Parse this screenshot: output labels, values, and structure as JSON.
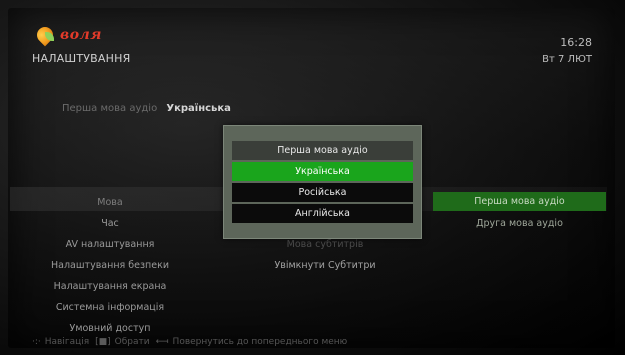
{
  "header": {
    "logo_text": "воля",
    "title": "НАЛАШТУВАННЯ",
    "time": "16:28",
    "date": "Вт 7 ЛЮТ"
  },
  "audio_setting": {
    "label": "Перша мова аудіо",
    "value": "Українська"
  },
  "menu": {
    "items": [
      {
        "label": "Мова"
      },
      {
        "label": "Час"
      },
      {
        "label": "AV налаштування"
      },
      {
        "label": "Налаштування безпеки"
      },
      {
        "label": "Налаштування екрана"
      },
      {
        "label": "Системна інформація"
      },
      {
        "label": "Умовний доступ"
      }
    ]
  },
  "submenu": {
    "items": [
      {
        "label": "Мова субтитрів"
      },
      {
        "label": "Увімкнути Субтитри"
      }
    ]
  },
  "right_list": {
    "items": [
      {
        "label": "Перша мова аудіо"
      },
      {
        "label": "Друга мова аудіо"
      }
    ]
  },
  "dialog": {
    "title": "Перша мова аудіо",
    "options": [
      {
        "label": "Українська",
        "selected": true
      },
      {
        "label": "Російська",
        "selected": false
      },
      {
        "label": "Англійська",
        "selected": false
      }
    ]
  },
  "footer": {
    "navigate_label": "Навігація",
    "select_label": "Обрати",
    "back_label": "Повернутись до попереднього меню"
  },
  "colors": {
    "selected_option": "#1aa51c",
    "active_list_item": "#1f6b1a",
    "brand_red": "#e43b2a"
  }
}
